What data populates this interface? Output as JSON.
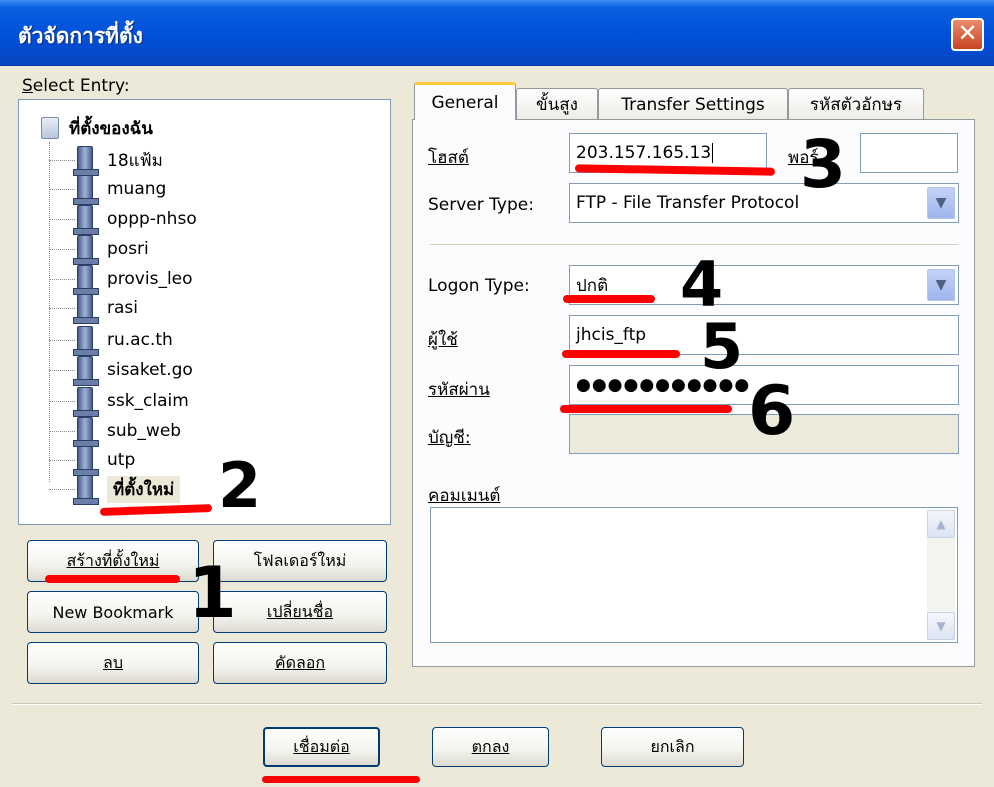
{
  "window": {
    "title": "ตัวจัดการที่ตั้ง"
  },
  "icons": {
    "close": "close-icon",
    "folder": "folder-icon",
    "server": "server-icon",
    "dropdown": "chevron-down-icon"
  },
  "select_entry": {
    "prefix": "S",
    "rest": "elect Entry:"
  },
  "tree": {
    "root": "ที่ตั้งของฉัน",
    "items": [
      "18แฟ้ม",
      "muang",
      "oppp-nhso",
      "posri",
      "provis_leo",
      "rasi",
      "ru.ac.th",
      "sisaket.go",
      "ssk_claim",
      "sub_web",
      "utp",
      "ที่ตั้งใหม่"
    ],
    "selected_index": 11
  },
  "left_buttons": {
    "new_site": "สร้างที่ตั้งใหม่",
    "new_folder": "โฟลเดอร์ใหม่",
    "new_bookmark": "New Bookmark",
    "rename": "เปลี่ยนชื่อ",
    "delete": "ลบ",
    "copy": "คัดลอก"
  },
  "tabs": [
    "General",
    "ขั้นสูง",
    "Transfer Settings",
    "รหัสตัวอักษร"
  ],
  "active_tab": 0,
  "general": {
    "host_label": "โฮสต์",
    "host_value": "203.157.165.13",
    "port_label": "พอร์",
    "port_value": "",
    "server_type_label": "Server Type:",
    "server_type_value": "FTP - File Transfer Protocol",
    "logon_type_label": "Logon Type:",
    "logon_type_value": "ปกติ",
    "user_label": "ผู้ใช้",
    "user_value": "jhcis_ftp",
    "password_label": "รหัสผ่าน",
    "password_value": "●●●●●●●●●●●",
    "account_label": "บัญชี:",
    "account_value": "",
    "comments_label": "คอมเมนต์",
    "comments_value": ""
  },
  "bottom_buttons": {
    "connect": "เชื่อมต่อ",
    "ok": "ตกลง",
    "cancel": "ยกเลิก"
  },
  "annotations": [
    "1",
    "2",
    "3",
    "4",
    "5",
    "6"
  ],
  "colors": {
    "titlebar": "#0050d8",
    "annotation_red": "#ff0000",
    "dialog_bg": "#ece9d8"
  }
}
